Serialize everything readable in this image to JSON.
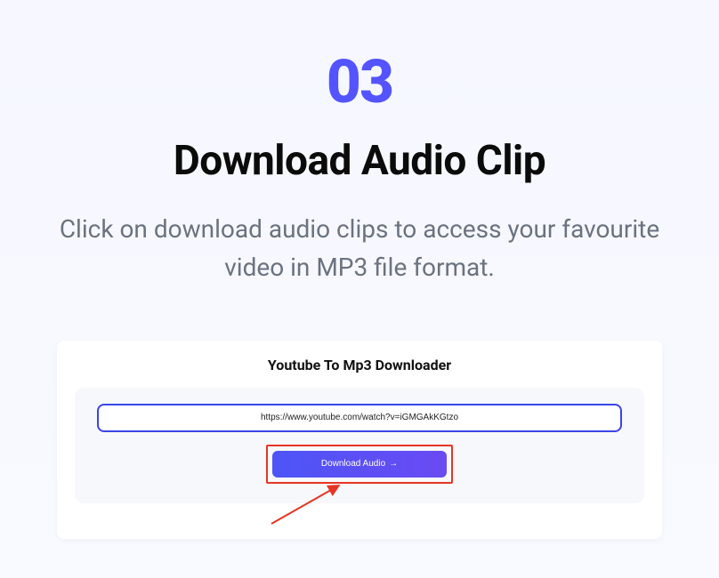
{
  "step": {
    "number": "03",
    "title": "Download Audio Clip",
    "description": "Click on download audio clips to access your favourite video in MP3 file format."
  },
  "mockup": {
    "title": "Youtube To Mp3 Downloader",
    "url_value": "https://www.youtube.com/watch?v=iGMGAkKGtzo",
    "button_label": "Download Audio",
    "button_arrow": "→"
  }
}
